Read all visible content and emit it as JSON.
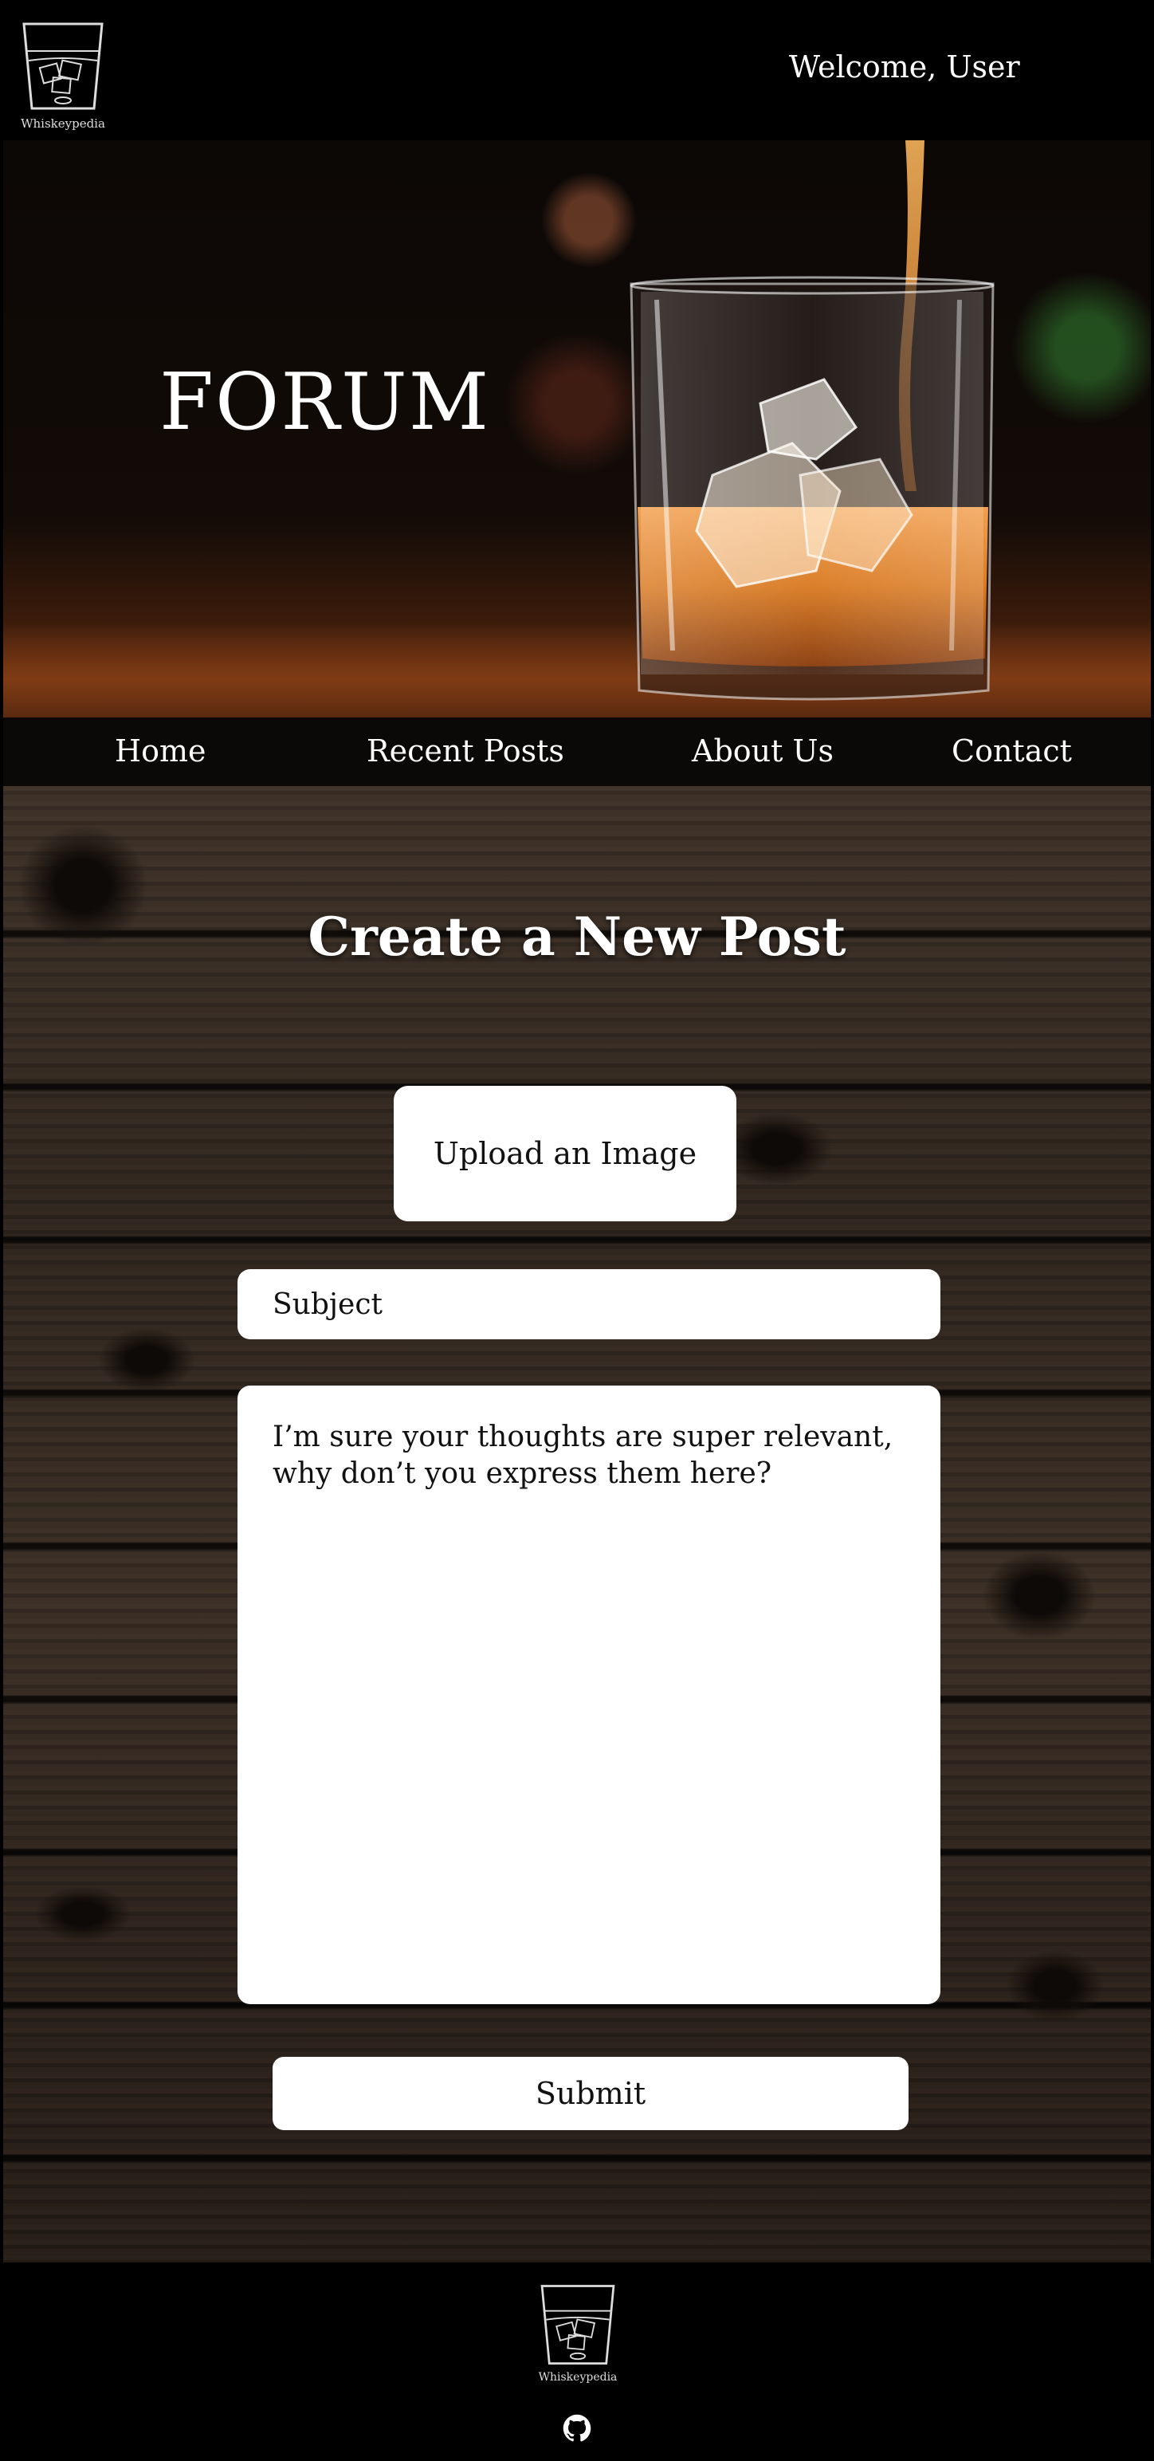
{
  "header": {
    "logo_text": "Whiskeypedia",
    "welcome": "Welcome, User"
  },
  "hero": {
    "title": "FORUM"
  },
  "nav": {
    "items": [
      {
        "label": "Home"
      },
      {
        "label": "Recent Posts"
      },
      {
        "label": "About Us"
      },
      {
        "label": "Contact"
      }
    ]
  },
  "form": {
    "title": "Create a New Post",
    "upload_label": "Upload an Image",
    "subject_placeholder": "Subject",
    "body_placeholder": "I’m sure your thoughts are super relevant, why don’t you express them here?",
    "submit_label": "Submit"
  },
  "footer": {
    "logo_text": "Whiskeypedia",
    "icons": [
      "github-icon"
    ]
  }
}
